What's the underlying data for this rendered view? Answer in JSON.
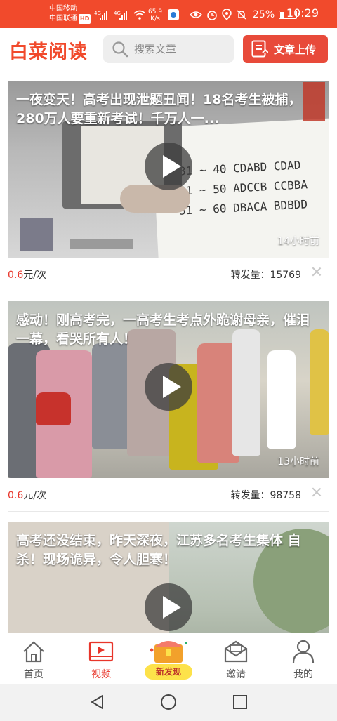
{
  "status_bar": {
    "carrier1": "中国移动",
    "carrier2": "中国联通",
    "hd_badge": "HD",
    "net_speed_value": "65.9",
    "net_speed_unit": "K/s",
    "battery": "25%",
    "battery_level": 0.25,
    "time": "10:29"
  },
  "header": {
    "logo": "白菜阅读",
    "search_placeholder": "搜索文章",
    "upload_label": "文章上传"
  },
  "colors": {
    "brand": "#f14a2c",
    "price": "#e8352a",
    "pill": "#fde24a"
  },
  "feed": {
    "items": [
      {
        "title": "一夜变天！高考出现泄题丑闻！18名考生被捕，280万人要重新考试！千万人一...",
        "age": "14小时前",
        "price_value": "0.6",
        "price_unit": "元/次",
        "shares_label": "转发量：",
        "shares_value": "15769",
        "answers": [
          "31 ~ 40 CDABD CDAD",
          "41 ~ 50 ADCCB CCBBA",
          "51 ~ 60 DBACA BDBDD"
        ]
      },
      {
        "title": "感动！刚高考完，一高考生考点外跪谢母亲，催泪一幕，看哭所有人！",
        "age": "13小时前",
        "price_value": "0.6",
        "price_unit": "元/次",
        "shares_label": "转发量：",
        "shares_value": "98758"
      },
      {
        "title": "高考还没结束，昨天深夜，江苏多名考生集体 自 杀！现场诡异，令人胆寒！"
      }
    ]
  },
  "tabbar": {
    "tabs": [
      {
        "label": "首页",
        "icon": "home-icon"
      },
      {
        "label": "视频",
        "icon": "video-icon",
        "active": true
      },
      {
        "label": "新发现",
        "icon": "treasure-chest-icon"
      },
      {
        "label": "邀请",
        "icon": "envelope-icon"
      },
      {
        "label": "我的",
        "icon": "person-icon"
      }
    ]
  },
  "system_nav": {
    "back": "back-triangle-icon",
    "home": "home-circle-icon",
    "recents": "recents-square-icon"
  }
}
